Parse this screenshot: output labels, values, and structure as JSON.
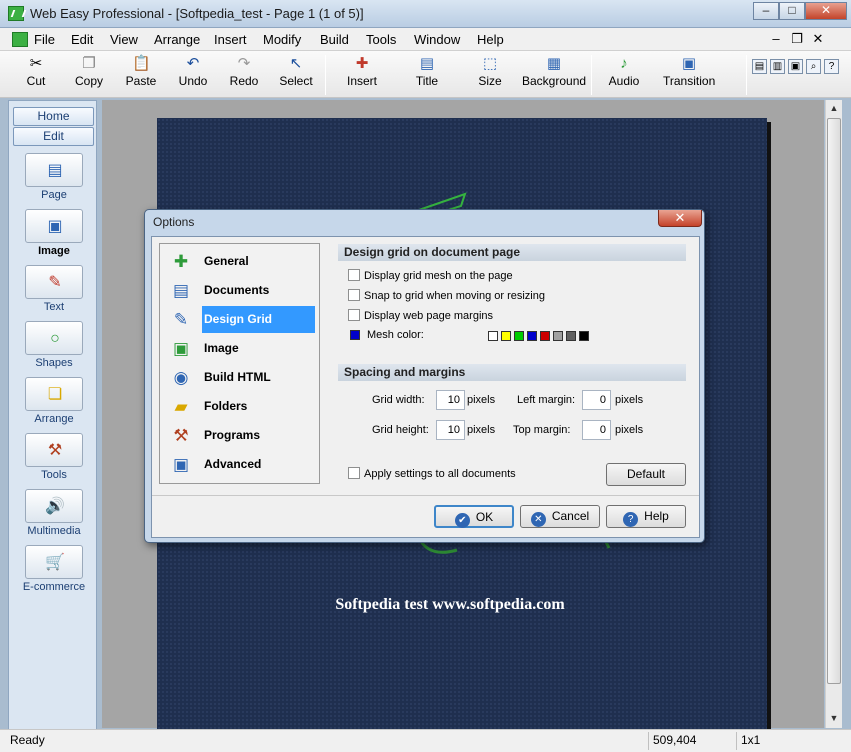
{
  "window": {
    "title": "Web Easy Professional - [Softpedia_test - Page 1 (1 of 5)]",
    "caption_buttons": {
      "minimize": "–",
      "maximize": "□",
      "close": "✕"
    }
  },
  "menubar": {
    "items": [
      "File",
      "Edit",
      "View",
      "Arrange",
      "Insert",
      "Modify",
      "Build",
      "Tools",
      "Window",
      "Help"
    ],
    "mdi": {
      "minimize": "–",
      "restore": "❐",
      "close": "✕"
    }
  },
  "toolbar": {
    "buttons": [
      {
        "label": "Cut",
        "icon": "scissors-icon",
        "glyph": "✂"
      },
      {
        "label": "Copy",
        "icon": "copy-icon",
        "glyph": "❐"
      },
      {
        "label": "Paste",
        "icon": "paste-icon",
        "glyph": "📋"
      },
      {
        "label": "Undo",
        "icon": "undo-icon",
        "glyph": "↶"
      },
      {
        "label": "Redo",
        "icon": "redo-icon",
        "glyph": "↷"
      },
      {
        "label": "Select",
        "icon": "pointer-icon",
        "glyph": "↖"
      },
      {
        "label": "Insert",
        "icon": "insert-icon",
        "glyph": "✚"
      },
      {
        "label": "Title",
        "icon": "title-icon",
        "glyph": "▤"
      },
      {
        "label": "Size",
        "icon": "size-icon",
        "glyph": "⬚"
      },
      {
        "label": "Background",
        "icon": "background-icon",
        "glyph": "▦"
      },
      {
        "label": "Audio",
        "icon": "audio-icon",
        "glyph": "♪"
      },
      {
        "label": "Transition",
        "icon": "transition-icon",
        "glyph": "▣"
      }
    ]
  },
  "sidebar": {
    "tabs": [
      "Home",
      "Edit"
    ],
    "items": [
      {
        "label": "Page",
        "icon": "page-icon",
        "glyph": "▤"
      },
      {
        "label": "Image",
        "icon": "image-icon",
        "glyph": "▣"
      },
      {
        "label": "Text",
        "icon": "text-icon",
        "glyph": "✎"
      },
      {
        "label": "Shapes",
        "icon": "shapes-icon",
        "glyph": "○"
      },
      {
        "label": "Arrange",
        "icon": "arrange-icon",
        "glyph": "❏"
      },
      {
        "label": "Tools",
        "icon": "tools-icon",
        "glyph": "⚒"
      },
      {
        "label": "Multimedia",
        "icon": "speaker-icon",
        "glyph": "🔊"
      },
      {
        "label": "E-commerce",
        "icon": "cart-icon",
        "glyph": "🛒"
      }
    ]
  },
  "canvas": {
    "caption": "Softpedia test www.softpedia.com"
  },
  "statusbar": {
    "status": "Ready",
    "coords": "509,404",
    "zoom": "1x1"
  },
  "dialog": {
    "title": "Options",
    "close": "✕",
    "nav": [
      {
        "label": "General",
        "icon": "general-icon",
        "glyph": "✚",
        "color": "#2e9b3a"
      },
      {
        "label": "Documents",
        "icon": "documents-icon",
        "glyph": "▤",
        "color": "#2f66b3"
      },
      {
        "label": "Design Grid",
        "icon": "design-grid-icon",
        "glyph": "✎",
        "color": "#2f66b3"
      },
      {
        "label": "Image",
        "icon": "image-icon",
        "glyph": "▣",
        "color": "#2e9b3a"
      },
      {
        "label": "Build HTML",
        "icon": "build-html-icon",
        "glyph": "◉",
        "color": "#2f66b3"
      },
      {
        "label": "Folders",
        "icon": "folders-icon",
        "glyph": "▰",
        "color": "#d9a800"
      },
      {
        "label": "Programs",
        "icon": "programs-icon",
        "glyph": "⚒",
        "color": "#b04020"
      },
      {
        "label": "Advanced",
        "icon": "advanced-icon",
        "glyph": "▣",
        "color": "#2f66b3"
      }
    ],
    "selected_nav": "Design Grid",
    "grid_section": {
      "heading": "Design grid on document page",
      "display_mesh": "Display grid mesh on the page",
      "snap": "Snap to grid when moving or resizing",
      "margins": "Display web page margins",
      "mesh_color_label": "Mesh color:",
      "mesh_color": "#0000cc",
      "palette": [
        "#ffffff",
        "#ffff00",
        "#00cc00",
        "#0000cc",
        "#cc0000",
        "#a0a0a0",
        "#606060",
        "#000000"
      ]
    },
    "spacing_section": {
      "heading": "Spacing and margins",
      "grid_width_label": "Grid  width:",
      "grid_width": "10",
      "grid_height_label": "Grid height:",
      "grid_height": "10",
      "left_margin_label": "Left margin:",
      "left_margin": "0",
      "top_margin_label": "Top  margin:",
      "top_margin": "0",
      "unit": "pixels"
    },
    "apply_all": "Apply settings to all documents",
    "default_button": "Default",
    "ok_button": "OK",
    "cancel_button": "Cancel",
    "help_button": "Help"
  }
}
